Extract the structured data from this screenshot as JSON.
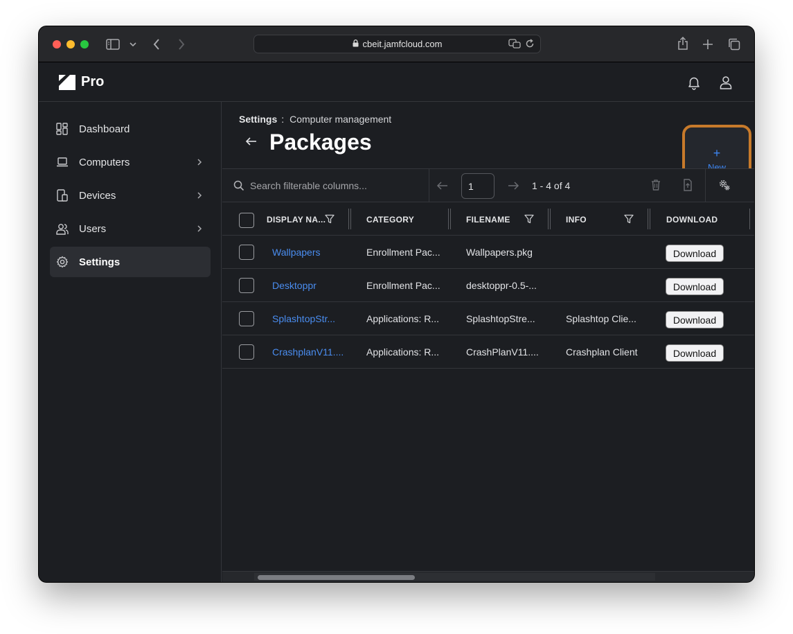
{
  "browser": {
    "url": "cbeit.jamfcloud.com"
  },
  "app": {
    "brand": "Pro"
  },
  "sidebar": {
    "items": [
      {
        "label": "Dashboard",
        "icon": "dashboard-icon"
      },
      {
        "label": "Computers",
        "icon": "laptop-icon"
      },
      {
        "label": "Devices",
        "icon": "devices-icon"
      },
      {
        "label": "Users",
        "icon": "users-icon"
      },
      {
        "label": "Settings",
        "icon": "gear-icon",
        "active": true
      }
    ]
  },
  "breadcrumb": {
    "section": "Settings",
    "separator": ":",
    "subsection": "Computer management"
  },
  "page": {
    "title": "Packages",
    "new_plus": "+",
    "new_label": "New"
  },
  "toolbar": {
    "search_placeholder": "Search filterable columns...",
    "page_value": "1",
    "count_text": "1 - 4 of 4"
  },
  "table": {
    "columns": [
      "DISPLAY NA...",
      "CATEGORY",
      "FILENAME",
      "INFO",
      "DOWNLOAD"
    ],
    "rows": [
      {
        "name": "Wallpapers",
        "category": "Enrollment Pac...",
        "filename": "Wallpapers.pkg",
        "info": "",
        "download": "Download"
      },
      {
        "name": "Desktoppr",
        "category": "Enrollment Pac...",
        "filename": "desktoppr-0.5-...",
        "info": "",
        "download": "Download"
      },
      {
        "name": "SplashtopStr...",
        "category": "Applications: R...",
        "filename": "SplashtopStre...",
        "info": "Splashtop Clie...",
        "download": "Download"
      },
      {
        "name": "CrashplanV11....",
        "category": "Applications: R...",
        "filename": "CrashPlanV11....",
        "info": "Crashplan Client",
        "download": "Download"
      }
    ]
  },
  "colors": {
    "accent": "#3d86f2",
    "highlight": "#c77a2b",
    "background": "#1c1e22"
  }
}
